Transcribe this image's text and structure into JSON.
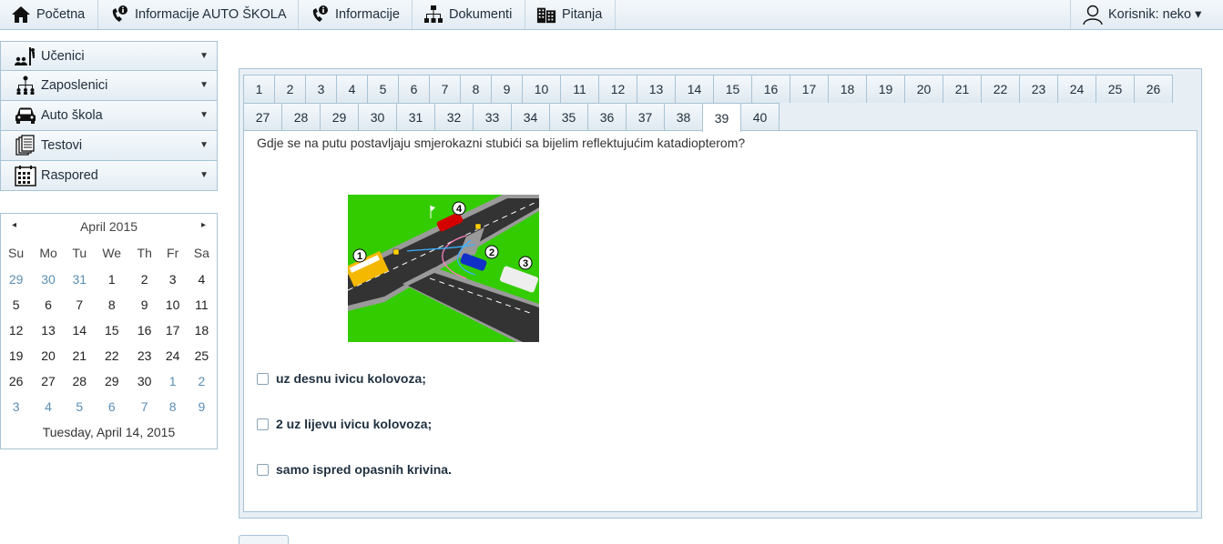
{
  "nav": {
    "items": [
      {
        "label": "Početna",
        "icon": "home-icon"
      },
      {
        "label": "Informacije AUTO ŠKOLA",
        "icon": "phone-info-icon"
      },
      {
        "label": "Informacije",
        "icon": "phone-info-icon"
      },
      {
        "label": "Dokumenti",
        "icon": "org-chart-icon"
      },
      {
        "label": "Pitanja",
        "icon": "building-icon"
      }
    ],
    "user_label": "Korisnik: neko ▾"
  },
  "sidebar": {
    "items": [
      {
        "label": "Učenici",
        "icon": "students-icon"
      },
      {
        "label": "Zaposlenici",
        "icon": "org-chart-icon"
      },
      {
        "label": "Auto škola",
        "icon": "car-icon"
      },
      {
        "label": "Testovi",
        "icon": "documents-icon"
      },
      {
        "label": "Raspored",
        "icon": "calendar-icon"
      }
    ]
  },
  "calendar": {
    "month_label": "April 2015",
    "prev": "◂",
    "next": "▸",
    "weekdays": [
      "Su",
      "Mo",
      "Tu",
      "We",
      "Th",
      "Fr",
      "Sa"
    ],
    "weeks": [
      [
        [
          "29",
          1
        ],
        [
          "30",
          1
        ],
        [
          "31",
          1
        ],
        [
          "1",
          0
        ],
        [
          "2",
          0
        ],
        [
          "3",
          0
        ],
        [
          "4",
          0
        ]
      ],
      [
        [
          "5",
          0
        ],
        [
          "6",
          0
        ],
        [
          "7",
          0
        ],
        [
          "8",
          0
        ],
        [
          "9",
          0
        ],
        [
          "10",
          0
        ],
        [
          "11",
          0
        ]
      ],
      [
        [
          "12",
          0
        ],
        [
          "13",
          0
        ],
        [
          "14",
          0
        ],
        [
          "15",
          0
        ],
        [
          "16",
          0
        ],
        [
          "17",
          0
        ],
        [
          "18",
          0
        ]
      ],
      [
        [
          "19",
          0
        ],
        [
          "20",
          0
        ],
        [
          "21",
          0
        ],
        [
          "22",
          0
        ],
        [
          "23",
          0
        ],
        [
          "24",
          0
        ],
        [
          "25",
          0
        ]
      ],
      [
        [
          "26",
          0
        ],
        [
          "27",
          0
        ],
        [
          "28",
          0
        ],
        [
          "29",
          0
        ],
        [
          "30",
          0
        ],
        [
          "1",
          1
        ],
        [
          "2",
          1
        ]
      ],
      [
        [
          "3",
          1
        ],
        [
          "4",
          1
        ],
        [
          "5",
          1
        ],
        [
          "6",
          1
        ],
        [
          "7",
          1
        ],
        [
          "8",
          1
        ],
        [
          "9",
          1
        ]
      ]
    ],
    "footer": "Tuesday, April 14, 2015"
  },
  "question": {
    "tabs": [
      "1",
      "2",
      "3",
      "4",
      "5",
      "6",
      "7",
      "8",
      "9",
      "10",
      "11",
      "12",
      "13",
      "14",
      "15",
      "16",
      "17",
      "18",
      "19",
      "20",
      "21",
      "22",
      "23",
      "24",
      "25",
      "26",
      "27",
      "28",
      "29",
      "30",
      "31",
      "32",
      "33",
      "34",
      "35",
      "36",
      "37",
      "38",
      "39",
      "40"
    ],
    "active_tab": "39",
    "text": "Gdje se na putu postavljaju smjerokazni stubići sa bijelim reflektujućim katadiopterom?",
    "image_markers": [
      "1",
      "2",
      "3",
      "4"
    ],
    "answers": [
      "uz desnu ivicu kolovoza;",
      "2 uz lijevu ivicu kolovoza;",
      "samo ispred opasnih krivina."
    ]
  },
  "colors": {
    "border": "#a8c3d6",
    "panel_bg": "#e7eff5",
    "grass": "#33cc00",
    "road": "#333333"
  }
}
